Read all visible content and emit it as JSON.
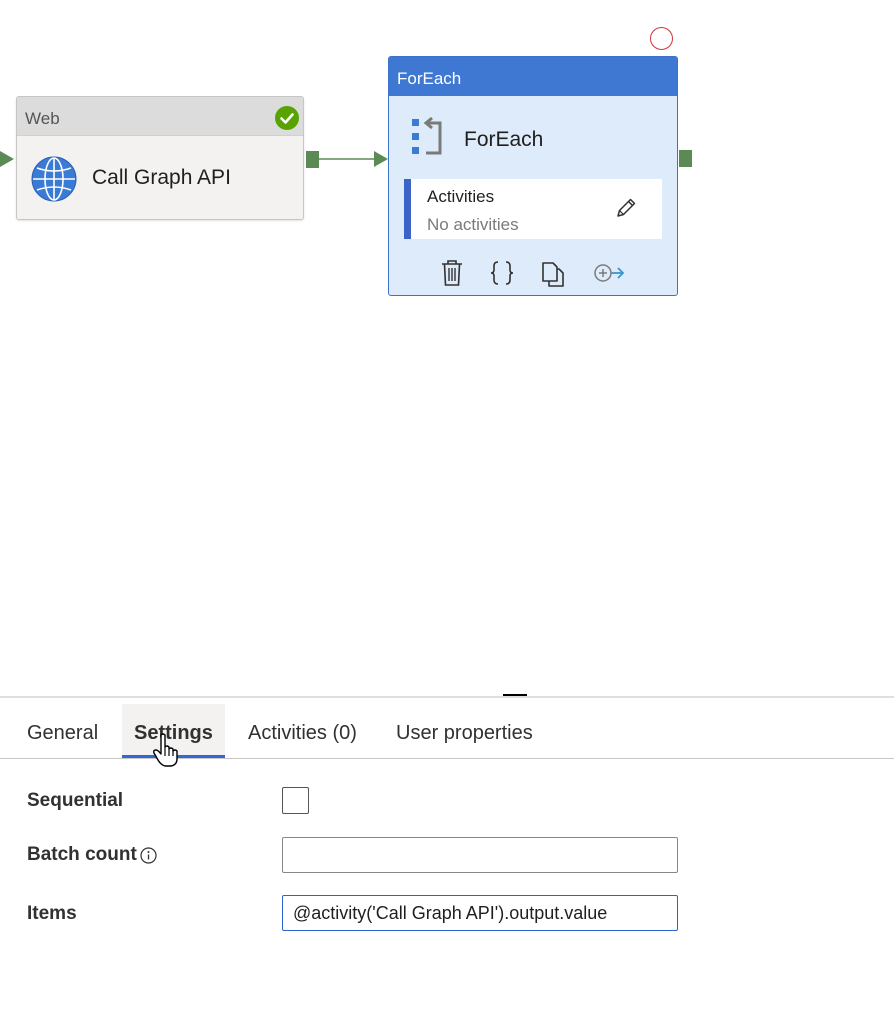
{
  "canvas": {
    "web_activity": {
      "type": "Web",
      "name": "Call Graph API",
      "status_icon": "success-check-icon",
      "icon": "globe-icon"
    },
    "foreach_activity": {
      "type": "ForEach",
      "name": "ForEach",
      "icon": "foreach-icon",
      "activities_title": "Activities",
      "activities_value": "No activities",
      "toolbar_icons": [
        "delete-icon",
        "code-icon",
        "copy-icon",
        "add-output-icon"
      ]
    },
    "colors": {
      "accent": "#3e78d3",
      "connector": "#5b8a55",
      "success": "#57a300",
      "error": "#d13438"
    }
  },
  "panel": {
    "tabs": [
      {
        "label": "General",
        "active": false
      },
      {
        "label": "Settings",
        "active": true
      },
      {
        "label": "Activities (0)",
        "active": false
      },
      {
        "label": "User properties",
        "active": false
      }
    ],
    "fields": {
      "sequential": {
        "label": "Sequential",
        "checked": false
      },
      "batch_count": {
        "label": "Batch count",
        "value": ""
      },
      "items": {
        "label": "Items",
        "value": "@activity('Call Graph API').output.value"
      }
    }
  }
}
